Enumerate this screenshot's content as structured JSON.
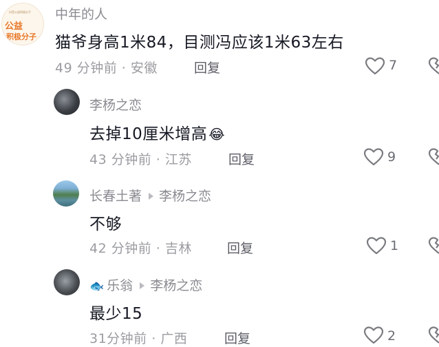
{
  "comments": [
    {
      "avatar": {
        "logo_line1": "公益",
        "logo_line2": "积极分子",
        "mini_text": "抖音公益积极分子"
      },
      "username": "中年的人",
      "content": "猫爷身高1米84，目测冯应该1米63左右",
      "time": "49 分钟前",
      "location": "安徽",
      "reply_label": "回复",
      "likes": "7"
    },
    {
      "username": "李杨之恋",
      "content": "去掉10厘米增高",
      "emoji": "😂",
      "time": "43 分钟前",
      "location": "江苏",
      "reply_label": "回复",
      "likes": "9"
    },
    {
      "username": "长春土著",
      "reply_to": "李杨之恋",
      "content": "不够",
      "time": "42 分钟前",
      "location": "吉林",
      "reply_label": "回复",
      "likes": "1"
    },
    {
      "username_emoji": "🐟",
      "username": "乐翁",
      "reply_to": "李杨之恋",
      "content": "最少15",
      "time": "31分钟前",
      "location": "广西",
      "reply_label": "回复",
      "likes": "2"
    }
  ],
  "separator": " · ",
  "icons": {
    "like": "heart-outline-icon",
    "dislike": "broken-heart-icon",
    "reply_arrow": "reply-arrow-icon"
  },
  "colors": {
    "text_primary": "#161823",
    "text_secondary": "#9b9ca1",
    "icon": "#7a7b80"
  }
}
